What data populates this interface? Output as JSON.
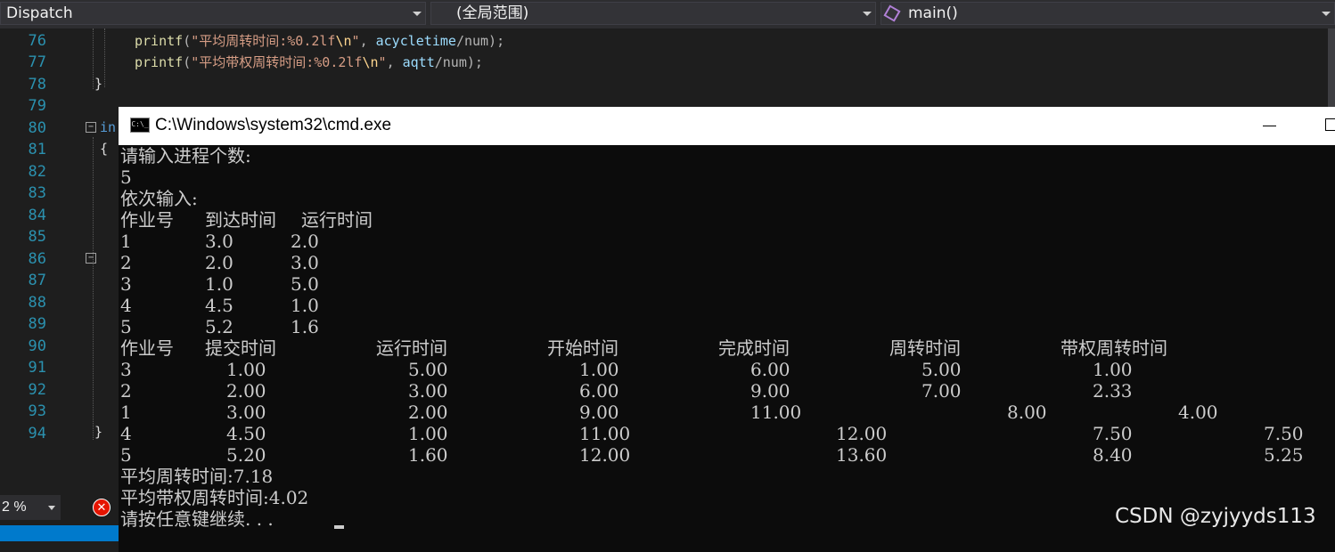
{
  "navbar": {
    "scope_project": "Dispatch",
    "scope_global": "(全局范围)",
    "scope_function": "main()",
    "function_icon": "cube-icon"
  },
  "editor": {
    "line_numbers": [
      "76",
      "77",
      "78",
      "79",
      "80",
      "81",
      "82",
      "83",
      "84",
      "85",
      "86",
      "87",
      "88",
      "89",
      "90",
      "91",
      "92",
      "93",
      "94"
    ],
    "line76": {
      "fn": "printf",
      "p1": "(",
      "str": "\"平均周转时间:%0.2lf",
      "esc": "\\n",
      "strend": "\"",
      "sep": ", ",
      "v": "acycletime",
      "op": "/num);"
    },
    "line77": {
      "fn": "printf",
      "p1": "(",
      "str": "\"平均带权周转时间:%0.2lf",
      "esc": "\\n",
      "strend": "\"",
      "sep": ", ",
      "v": "aqtt",
      "op": "/num);"
    },
    "line78": "}",
    "line80": "in",
    "line81": "{",
    "line94": "}"
  },
  "cmd": {
    "title": "C:\\Windows\\system32\\cmd.exe",
    "icon": "cmd-icon",
    "prompt_count": "请输入进程个数:",
    "count_value": "5",
    "prompt_input": "依次输入:",
    "input_headers": [
      "作业号",
      "到达时间",
      "运行时间"
    ],
    "input_rows": [
      [
        "1",
        "3.0",
        "2.0"
      ],
      [
        "2",
        "2.0",
        "3.0"
      ],
      [
        "3",
        "1.0",
        "5.0"
      ],
      [
        "4",
        "4.5",
        "1.0"
      ],
      [
        "5",
        "5.2",
        "1.6"
      ]
    ],
    "result_headers": [
      "作业号",
      "提交时间",
      "运行时间",
      "开始时间",
      "完成时间",
      "周转时间",
      "带权周转时间"
    ],
    "result_rows": [
      [
        "3",
        "1.00",
        "5.00",
        "1.00",
        "6.00",
        "5.00",
        "1.00"
      ],
      [
        "2",
        "2.00",
        "3.00",
        "6.00",
        "9.00",
        "7.00",
        "2.33"
      ],
      [
        "1",
        "3.00",
        "2.00",
        "9.00",
        "11.00",
        "8.00",
        "4.00"
      ],
      [
        "4",
        "4.50",
        "1.00",
        "11.00",
        "12.00",
        "7.50",
        "7.50"
      ],
      [
        "5",
        "5.20",
        "1.60",
        "12.00",
        "13.60",
        "8.40",
        "5.25"
      ]
    ],
    "avg_turnaround": "平均周转时间:7.18",
    "avg_weighted": "平均带权周转时间:4.02",
    "press_key": "请按任意键继续. . ."
  },
  "status": {
    "zoom": "2 %",
    "error_icon": "error-icon",
    "error_glyph": "✕"
  },
  "watermark": "CSDN @zyjyyds113"
}
